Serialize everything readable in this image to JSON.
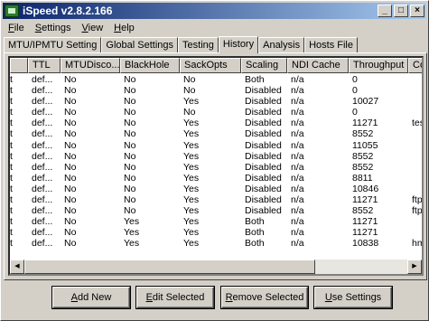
{
  "window": {
    "title": "iSpeed v2.8.2.166",
    "controls": {
      "minimize": "_",
      "maximize": "□",
      "close": "×"
    }
  },
  "menu": [
    {
      "ul": "F",
      "rest": "ile"
    },
    {
      "ul": "S",
      "rest": "ettings"
    },
    {
      "ul": "V",
      "rest": "iew"
    },
    {
      "ul": "H",
      "rest": "elp"
    }
  ],
  "tabs": [
    "MTU/IPMTU Setting",
    "Global Settings",
    "Testing",
    "History",
    "Analysis",
    "Hosts File"
  ],
  "active_tab": "History",
  "table": {
    "columns": [
      "",
      "TTL",
      "MTUDisco...",
      "BlackHole",
      "SackOpts",
      "Scaling",
      "NDI Cache",
      "Throughput",
      "Comm"
    ],
    "rows": [
      [
        "t",
        "def...",
        "No",
        "No",
        "No",
        "Both",
        "n/a",
        "0",
        ""
      ],
      [
        "t",
        "def...",
        "No",
        "No",
        "No",
        "Disabled",
        "n/a",
        "0",
        ""
      ],
      [
        "t",
        "def...",
        "No",
        "No",
        "Yes",
        "Disabled",
        "n/a",
        "10027",
        ""
      ],
      [
        "t",
        "def...",
        "No",
        "No",
        "No",
        "Disabled",
        "n/a",
        "0",
        ""
      ],
      [
        "t",
        "def...",
        "No",
        "No",
        "Yes",
        "Disabled",
        "n/a",
        "11271",
        "testir"
      ],
      [
        "t",
        "def...",
        "No",
        "No",
        "Yes",
        "Disabled",
        "n/a",
        "8552",
        ""
      ],
      [
        "t",
        "def...",
        "No",
        "No",
        "Yes",
        "Disabled",
        "n/a",
        "11055",
        ""
      ],
      [
        "t",
        "def...",
        "No",
        "No",
        "Yes",
        "Disabled",
        "n/a",
        "8552",
        ""
      ],
      [
        "t",
        "def...",
        "No",
        "No",
        "Yes",
        "Disabled",
        "n/a",
        "8552",
        ""
      ],
      [
        "t",
        "def...",
        "No",
        "No",
        "Yes",
        "Disabled",
        "n/a",
        "8811",
        ""
      ],
      [
        "t",
        "def...",
        "No",
        "No",
        "Yes",
        "Disabled",
        "n/a",
        "10846",
        ""
      ],
      [
        "t",
        "def...",
        "No",
        "No",
        "Yes",
        "Disabled",
        "n/a",
        "11271",
        "ftp.c"
      ],
      [
        "t",
        "def...",
        "No",
        "No",
        "Yes",
        "Disabled",
        "n/a",
        "8552",
        "ftp.m"
      ],
      [
        "t",
        "def...",
        "No",
        "Yes",
        "Yes",
        "Both",
        "n/a",
        "11271",
        ""
      ],
      [
        "t",
        "def...",
        "No",
        "Yes",
        "Yes",
        "Both",
        "n/a",
        "11271",
        ""
      ],
      [
        "t",
        "def...",
        "No",
        "Yes",
        "Yes",
        "Both",
        "n/a",
        "10838",
        "hms."
      ]
    ]
  },
  "buttons": [
    {
      "name": "add-new-button",
      "ul": "A",
      "rest": "dd New"
    },
    {
      "name": "edit-selected-button",
      "ul": "E",
      "rest": "dit Selected"
    },
    {
      "name": "remove-selected-button",
      "ul": "R",
      "rest": "emove Selected"
    },
    {
      "name": "use-settings-button",
      "ul": "U",
      "rest": "se Settings"
    }
  ]
}
